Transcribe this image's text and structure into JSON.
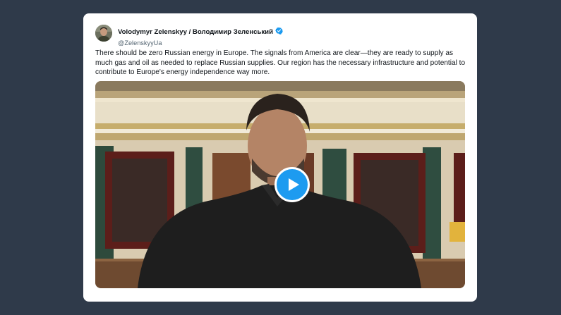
{
  "tweet": {
    "author": {
      "display_name": "Volodymyr Zelenskyy / Володимир Зеленський",
      "handle": "@ZelenskyyUa",
      "verified": true
    },
    "text": "There should be zero Russian energy in Europe. The signals from America are clear—they are ready to supply as much gas and oil as needed to replace Russian supplies. Our region has the necessary infrastructure and potential to contribute to Europe's energy independence way more."
  },
  "colors": {
    "page_background": "#2f3a4a",
    "card_background": "#ffffff",
    "accent": "#1d9bf0",
    "text_primary": "#0f1419",
    "text_secondary": "#536471"
  },
  "icons": {
    "verified": "verified-badge-icon",
    "play": "play-icon"
  }
}
